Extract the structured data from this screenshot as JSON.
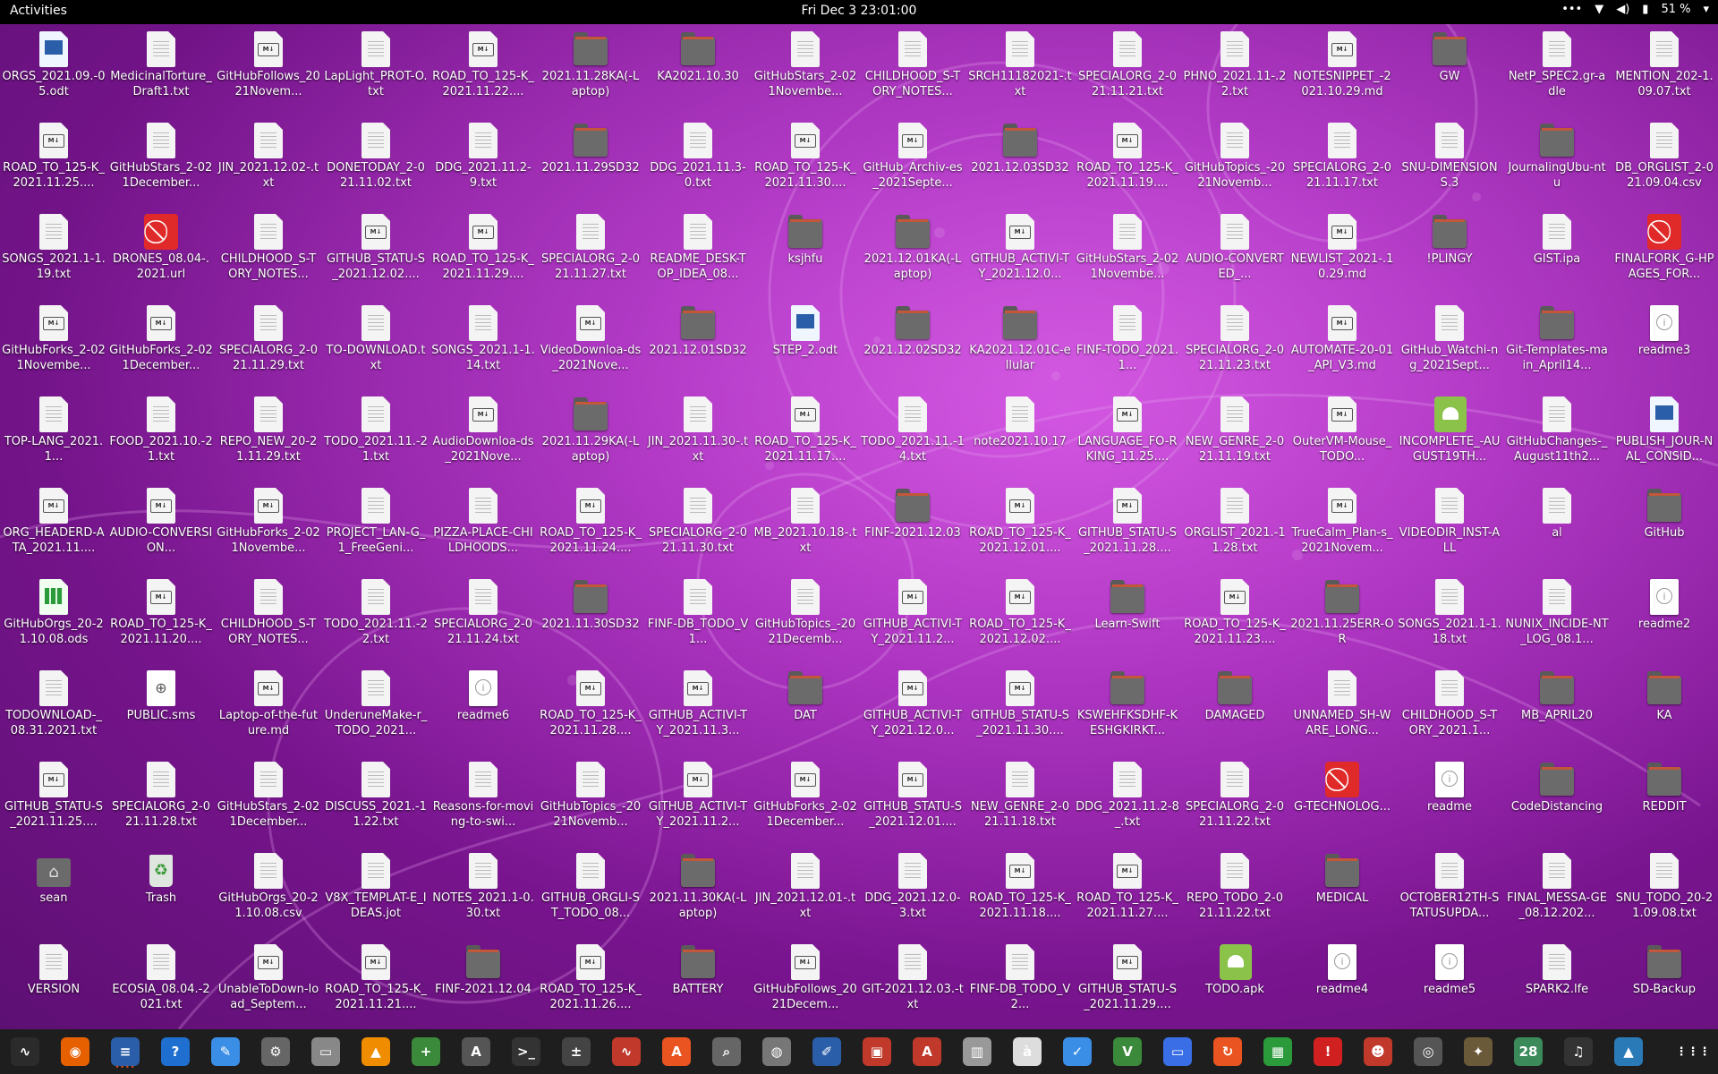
{
  "topbar": {
    "activities": "Activities",
    "clock": "Fri Dec 3  23:01:00",
    "battery": "51 %",
    "tray_icons": [
      "more-icon",
      "wifi-icon",
      "volume-icon",
      "battery-icon",
      "dropdown-icon"
    ]
  },
  "desktop": [
    {
      "l": "ORGS_2021.09.-05.odt",
      "t": "odt"
    },
    {
      "l": "MedicinalTorture_Draft1.txt",
      "t": "txt"
    },
    {
      "l": "GitHubFollows_2021Novem...",
      "t": "md"
    },
    {
      "l": "LapLight_PROT-O.txt",
      "t": "txt"
    },
    {
      "l": "ROAD_TO_125-K_2021.11.22....",
      "t": "md"
    },
    {
      "l": "2021.11.28KA(-Laptop)",
      "t": "folder"
    },
    {
      "l": "KA2021.10.30",
      "t": "folder"
    },
    {
      "l": "GitHubStars_2-021Novembe...",
      "t": "txt"
    },
    {
      "l": "CHILDHOOD_S-TORY_NOTES...",
      "t": "txt"
    },
    {
      "l": "SRCH11182021-.txt",
      "t": "txt"
    },
    {
      "l": "SPECIALORG_2-021.11.21.txt",
      "t": "txt"
    },
    {
      "l": "PHNO_2021.11-.22.txt",
      "t": "txt"
    },
    {
      "l": "NOTESNIPPET_-2021.10.29.md",
      "t": "md"
    },
    {
      "l": "GW",
      "t": "folder"
    },
    {
      "l": "NetP_SPEC2.gr-adle",
      "t": "txt"
    },
    {
      "l": "MENTION_202-1.09.07.txt",
      "t": "txt"
    },
    {
      "l": "ROAD_TO_125-K_2021.11.25....",
      "t": "md"
    },
    {
      "l": "GitHubStars_2-021December...",
      "t": "txt"
    },
    {
      "l": "JIN_2021.12.02-.txt",
      "t": "txt"
    },
    {
      "l": "DONETODAY_2-021.11.02.txt",
      "t": "txt"
    },
    {
      "l": "DDG_2021.11.2-9.txt",
      "t": "txt"
    },
    {
      "l": "2021.11.29SD32",
      "t": "folder"
    },
    {
      "l": "DDG_2021.11.3-0.txt",
      "t": "txt"
    },
    {
      "l": "ROAD_TO_125-K_2021.11.30....",
      "t": "md"
    },
    {
      "l": "GitHub_Archiv-es_2021Septe...",
      "t": "md"
    },
    {
      "l": "2021.12.03SD32",
      "t": "folder"
    },
    {
      "l": "ROAD_TO_125-K_2021.11.19....",
      "t": "md"
    },
    {
      "l": "GitHubTopics_-2021Novemb...",
      "t": "txt"
    },
    {
      "l": "SPECIALORG_2-021.11.17.txt",
      "t": "txt"
    },
    {
      "l": "SNU-DIMENSIONS.3",
      "t": "txt"
    },
    {
      "l": "JournalingUbu-ntu",
      "t": "folder"
    },
    {
      "l": "DB_ORGLIST_2-021.09.04.csv",
      "t": "txt"
    },
    {
      "l": "SONGS_2021.1-1.19.txt",
      "t": "txt"
    },
    {
      "l": "DRONES_08.04-.2021.url",
      "t": "forbid"
    },
    {
      "l": "CHILDHOOD_S-TORY_NOTES...",
      "t": "txt"
    },
    {
      "l": "GITHUB_STATU-S_2021.12.02....",
      "t": "md"
    },
    {
      "l": "ROAD_TO_125-K_2021.11.29....",
      "t": "md"
    },
    {
      "l": "SPECIALORG_2-021.11.27.txt",
      "t": "txt"
    },
    {
      "l": "README_DESK-TOP_IDEA_08...",
      "t": "txt"
    },
    {
      "l": "ksjhfu",
      "t": "folder"
    },
    {
      "l": "2021.12.01KA(-Laptop)",
      "t": "folder"
    },
    {
      "l": "GITHUB_ACTIVI-TY_2021.12.0...",
      "t": "md"
    },
    {
      "l": "GitHubStars_2-021Novembe...",
      "t": "txt"
    },
    {
      "l": "AUDIO-CONVERTED_...",
      "t": "txt"
    },
    {
      "l": "NEWLIST_2021-.10.29.md",
      "t": "md"
    },
    {
      "l": "!PLINGY",
      "t": "folder"
    },
    {
      "l": "GIST.ipa",
      "t": "txt"
    },
    {
      "l": "FINALFORK_G-HPAGES_FOR...",
      "t": "forbid"
    },
    {
      "l": "GitHubForks_2-021Novembe...",
      "t": "md"
    },
    {
      "l": "GitHubForks_2-021December...",
      "t": "md"
    },
    {
      "l": "SPECIALORG_2-021.11.29.txt",
      "t": "txt"
    },
    {
      "l": "TO-DOWNLOAD.txt",
      "t": "txt"
    },
    {
      "l": "SONGS_2021.1-1.14.txt",
      "t": "txt"
    },
    {
      "l": "VideoDownloa-ds_2021Nove...",
      "t": "md"
    },
    {
      "l": "2021.12.01SD32",
      "t": "folder"
    },
    {
      "l": "STEP_2.odt",
      "t": "odt"
    },
    {
      "l": "2021.12.02SD32",
      "t": "folder"
    },
    {
      "l": "KA2021.12.01C-ellular",
      "t": "folder"
    },
    {
      "l": "FINF-TODO_2021.1...",
      "t": "txt"
    },
    {
      "l": "SPECIALORG_2-021.11.23.txt",
      "t": "txt"
    },
    {
      "l": "AUTOMATE-20-01_API_V3.md",
      "t": "md"
    },
    {
      "l": "GitHub_Watchi-ng_2021Sept...",
      "t": "txt"
    },
    {
      "l": "Git-Templates-main_April14...",
      "t": "folder"
    },
    {
      "l": "readme3",
      "t": "info"
    },
    {
      "l": "TOP-LANG_2021.1...",
      "t": "txt"
    },
    {
      "l": "FOOD_2021.10.-21.txt",
      "t": "txt"
    },
    {
      "l": "REPO_NEW_20-21.11.29.txt",
      "t": "txt"
    },
    {
      "l": "TODO_2021.11.-21.txt",
      "t": "txt"
    },
    {
      "l": "AudioDownloa-ds_2021Nove...",
      "t": "md"
    },
    {
      "l": "2021.11.29KA(-Laptop)",
      "t": "folder"
    },
    {
      "l": "JIN_2021.11.30-.txt",
      "t": "txt"
    },
    {
      "l": "ROAD_TO_125-K_2021.11.17....",
      "t": "md"
    },
    {
      "l": "TODO_2021.11.-14.txt",
      "t": "txt"
    },
    {
      "l": "note2021.10.17",
      "t": "txt"
    },
    {
      "l": "LANGUAGE_FO-RKING_11.25....",
      "t": "md"
    },
    {
      "l": "NEW_GENRE_2-021.11.19.txt",
      "t": "txt"
    },
    {
      "l": "OuterVM-Mouse_TODO...",
      "t": "md"
    },
    {
      "l": "INCOMPLETE_-AUGUST19TH...",
      "t": "apk"
    },
    {
      "l": "GitHubChanges-_August11th2...",
      "t": "txt"
    },
    {
      "l": "PUBLISH_JOUR-NAL_CONSID...",
      "t": "odt"
    },
    {
      "l": "ORG_HEADERD-ATA_2021.11....",
      "t": "md"
    },
    {
      "l": "AUDIO-CONVERSION...",
      "t": "md"
    },
    {
      "l": "GitHubForks_2-021Novembe...",
      "t": "md"
    },
    {
      "l": "PROJECT_LAN-G_1_FreeGeni...",
      "t": "txt"
    },
    {
      "l": "PIZZA-PLACE-CHILDHOODS...",
      "t": "txt"
    },
    {
      "l": "ROAD_TO_125-K_2021.11.24....",
      "t": "md"
    },
    {
      "l": "SPECIALORG_2-021.11.30.txt",
      "t": "txt"
    },
    {
      "l": "MB_2021.10.18-.txt",
      "t": "txt"
    },
    {
      "l": "FINF-2021.12.03",
      "t": "folder"
    },
    {
      "l": "ROAD_TO_125-K_2021.12.01....",
      "t": "md"
    },
    {
      "l": "GITHUB_STATU-S_2021.11.28....",
      "t": "md"
    },
    {
      "l": "ORGLIST_2021.-11.28.txt",
      "t": "txt"
    },
    {
      "l": "TrueCalm_Plan-s_2021Novem...",
      "t": "md"
    },
    {
      "l": "VIDEODIR_INST-ALL",
      "t": "txt"
    },
    {
      "l": "al",
      "t": "txt"
    },
    {
      "l": "GitHub",
      "t": "folder"
    },
    {
      "l": "GitHubOrgs_20-21.10.08.ods",
      "t": "ods"
    },
    {
      "l": "ROAD_TO_125-K_2021.11.20....",
      "t": "md"
    },
    {
      "l": "CHILDHOOD_S-TORY_NOTES...",
      "t": "txt"
    },
    {
      "l": "TODO_2021.11.-22.txt",
      "t": "txt"
    },
    {
      "l": "SPECIALORG_2-021.11.24.txt",
      "t": "txt"
    },
    {
      "l": "2021.11.30SD32",
      "t": "folder"
    },
    {
      "l": "FINF-DB_TODO_V1...",
      "t": "txt"
    },
    {
      "l": "GitHubTopics_-2021Decemb...",
      "t": "txt"
    },
    {
      "l": "GITHUB_ACTIVI-TY_2021.11.2...",
      "t": "md"
    },
    {
      "l": "ROAD_TO_125-K_2021.12.02....",
      "t": "md"
    },
    {
      "l": "Learn-Swift",
      "t": "folder"
    },
    {
      "l": "ROAD_TO_125-K_2021.11.23....",
      "t": "md"
    },
    {
      "l": "2021.11.25ERR-OR",
      "t": "folder"
    },
    {
      "l": "SONGS_2021.1-1.18.txt",
      "t": "txt"
    },
    {
      "l": "NUNIX_INCIDE-NT_LOG_08.1...",
      "t": "txt"
    },
    {
      "l": "readme2",
      "t": "info"
    },
    {
      "l": "TODOWNLOAD-_08.31.2021.txt",
      "t": "txt"
    },
    {
      "l": "PUBLIC.sms",
      "t": "sms"
    },
    {
      "l": "Laptop-of-the-future.md",
      "t": "md"
    },
    {
      "l": "UnderuneMake-r_TODO_2021...",
      "t": "txt"
    },
    {
      "l": "readme6",
      "t": "info"
    },
    {
      "l": "ROAD_TO_125-K_2021.11.28....",
      "t": "md"
    },
    {
      "l": "GITHUB_ACTIVI-TY_2021.11.3...",
      "t": "md"
    },
    {
      "l": "DAT",
      "t": "folder"
    },
    {
      "l": "GITHUB_ACTIVI-TY_2021.12.0...",
      "t": "md"
    },
    {
      "l": "GITHUB_STATU-S_2021.11.30....",
      "t": "md"
    },
    {
      "l": "KSWEHFKSDHF-KESHGKIRKT...",
      "t": "folder"
    },
    {
      "l": "DAMAGED",
      "t": "folder"
    },
    {
      "l": "UNNAMED_SH-WARE_LONG...",
      "t": "txt"
    },
    {
      "l": "CHILDHOOD_S-TORY_2021.1...",
      "t": "txt"
    },
    {
      "l": "MB_APRIL20",
      "t": "folder"
    },
    {
      "l": "KA",
      "t": "folder"
    },
    {
      "l": "GITHUB_STATU-S_2021.11.25....",
      "t": "md"
    },
    {
      "l": "SPECIALORG_2-021.11.28.txt",
      "t": "txt"
    },
    {
      "l": "GitHubStars_2-021December...",
      "t": "txt"
    },
    {
      "l": "DISCUSS_2021.-11.22.txt",
      "t": "txt"
    },
    {
      "l": "Reasons-for-moving-to-swi...",
      "t": "txt"
    },
    {
      "l": "GitHubTopics_-2021Novemb...",
      "t": "txt"
    },
    {
      "l": "GITHUB_ACTIVI-TY_2021.11.2...",
      "t": "md"
    },
    {
      "l": "GitHubForks_2-021December...",
      "t": "md"
    },
    {
      "l": "GITHUB_STATU-S_2021.12.01....",
      "t": "md"
    },
    {
      "l": "NEW_GENRE_2-021.11.18.txt",
      "t": "txt"
    },
    {
      "l": "DDG_2021.11.2-8_.txt",
      "t": "txt"
    },
    {
      "l": "SPECIALORG_2-021.11.22.txt",
      "t": "txt"
    },
    {
      "l": "G-TECHNOLOG...",
      "t": "forbid"
    },
    {
      "l": "readme",
      "t": "info"
    },
    {
      "l": "CodeDistancing",
      "t": "folder"
    },
    {
      "l": "REDDIT",
      "t": "folder"
    },
    {
      "l": "sean",
      "t": "home"
    },
    {
      "l": "Trash",
      "t": "trash"
    },
    {
      "l": "GitHubOrgs_20-21.10.08.csv",
      "t": "txt"
    },
    {
      "l": "V8X_TEMPLAT-E_IDEAS.jot",
      "t": "txt"
    },
    {
      "l": "NOTES_2021.1-0.30.txt",
      "t": "txt"
    },
    {
      "l": "GITHUB_ORGLI-ST_TODO_08...",
      "t": "txt"
    },
    {
      "l": "2021.11.30KA(-Laptop)",
      "t": "folder"
    },
    {
      "l": "JIN_2021.12.01-.txt",
      "t": "txt"
    },
    {
      "l": "DDG_2021.12.0-3.txt",
      "t": "txt"
    },
    {
      "l": "ROAD_TO_125-K_2021.11.18....",
      "t": "md"
    },
    {
      "l": "ROAD_TO_125-K_2021.11.27....",
      "t": "md"
    },
    {
      "l": "REPO_TODO_2-021.11.22.txt",
      "t": "txt"
    },
    {
      "l": "MEDICAL",
      "t": "folder"
    },
    {
      "l": "OCTOBER12TH-STATUSUPDA...",
      "t": "txt"
    },
    {
      "l": "FINAL_MESSA-GE_08.12.202...",
      "t": "txt"
    },
    {
      "l": "SNU_TODO_20-21.09.08.txt",
      "t": "txt"
    },
    {
      "l": "VERSION",
      "t": "txt"
    },
    {
      "l": "ECOSIA_08.04.-2021.txt",
      "t": "txt"
    },
    {
      "l": "UnableToDown-load_Septem...",
      "t": "md"
    },
    {
      "l": "ROAD_TO_125-K_2021.11.21....",
      "t": "md"
    },
    {
      "l": "FINF-2021.12.04",
      "t": "folder"
    },
    {
      "l": "ROAD_TO_125-K_2021.11.26....",
      "t": "md"
    },
    {
      "l": "BATTERY",
      "t": "folder"
    },
    {
      "l": "GitHubFollows_2021Decem...",
      "t": "md"
    },
    {
      "l": "GIT-2021.12.03.-txt",
      "t": "txt"
    },
    {
      "l": "FINF-DB_TODO_V2...",
      "t": "txt"
    },
    {
      "l": "GITHUB_STATU-S_2021.11.29....",
      "t": "md"
    },
    {
      "l": "TODO.apk",
      "t": "apk"
    },
    {
      "l": "readme4",
      "t": "info"
    },
    {
      "l": "readme5",
      "t": "info"
    },
    {
      "l": "SPARK2.lfe",
      "t": "txt"
    },
    {
      "l": "SD-Backup",
      "t": "folder"
    }
  ],
  "dock": [
    {
      "name": "system-monitor-icon",
      "color": "#2b2b2b",
      "glyph": "∿"
    },
    {
      "name": "firefox-icon",
      "color": "#e66000",
      "glyph": "◉"
    },
    {
      "name": "writer-icon",
      "color": "#2a5ea8",
      "glyph": "≡"
    },
    {
      "name": "help-icon",
      "color": "#1f6fd0",
      "glyph": "?"
    },
    {
      "name": "text-editor-icon",
      "color": "#3a8ee6",
      "glyph": "✎"
    },
    {
      "name": "settings-icon",
      "color": "#666",
      "glyph": "⚙"
    },
    {
      "name": "files-icon",
      "color": "#888",
      "glyph": "▭"
    },
    {
      "name": "vlc-icon",
      "color": "#f08c00",
      "glyph": "▲"
    },
    {
      "name": "terminal-plus-icon",
      "color": "#3b8a3b",
      "glyph": "+"
    },
    {
      "name": "software-updater-icon",
      "color": "#555",
      "glyph": "A"
    },
    {
      "name": "terminal-icon",
      "color": "#333",
      "glyph": ">_"
    },
    {
      "name": "calculator-icon",
      "color": "#444",
      "glyph": "±"
    },
    {
      "name": "waveform-icon",
      "color": "#c0392b",
      "glyph": "∿"
    },
    {
      "name": "app-store-icon",
      "color": "#e95420",
      "glyph": "A"
    },
    {
      "name": "search-tool-icon",
      "color": "#666",
      "glyph": "⌕"
    },
    {
      "name": "disk-usage-icon",
      "color": "#777",
      "glyph": "◍"
    },
    {
      "name": "draw-icon",
      "color": "#2a5ea8",
      "glyph": "✐"
    },
    {
      "name": "screenshot-icon",
      "color": "#c0392b",
      "glyph": "▣"
    },
    {
      "name": "font-viewer-icon",
      "color": "#c0392b",
      "glyph": "A"
    },
    {
      "name": "archive-icon",
      "color": "#999",
      "glyph": "▥"
    },
    {
      "name": "character-map-icon",
      "color": "#ddd",
      "glyph": "à"
    },
    {
      "name": "tasks-icon",
      "color": "#3a8ee6",
      "glyph": "✓"
    },
    {
      "name": "vim-icon",
      "color": "#3b8a3b",
      "glyph": "V"
    },
    {
      "name": "remote-desktop-icon",
      "color": "#3a6ee6",
      "glyph": "▭"
    },
    {
      "name": "backup-icon",
      "color": "#e95420",
      "glyph": "↻"
    },
    {
      "name": "calc-icon",
      "color": "#2b9a3b",
      "glyph": "▦"
    },
    {
      "name": "alert-icon",
      "color": "#d02020",
      "glyph": "!"
    },
    {
      "name": "game-icon",
      "color": "#c0392b",
      "glyph": "☻"
    },
    {
      "name": "camera-icon",
      "color": "#555",
      "glyph": "◎"
    },
    {
      "name": "gimp-icon",
      "color": "#6b5a3a",
      "glyph": "✦"
    },
    {
      "name": "calendar-icon",
      "color": "#3a8a5a",
      "glyph": "28"
    },
    {
      "name": "music-icon",
      "color": "#333",
      "glyph": "♫"
    },
    {
      "name": "photos-icon",
      "color": "#2a7ab8",
      "glyph": "▲"
    }
  ]
}
